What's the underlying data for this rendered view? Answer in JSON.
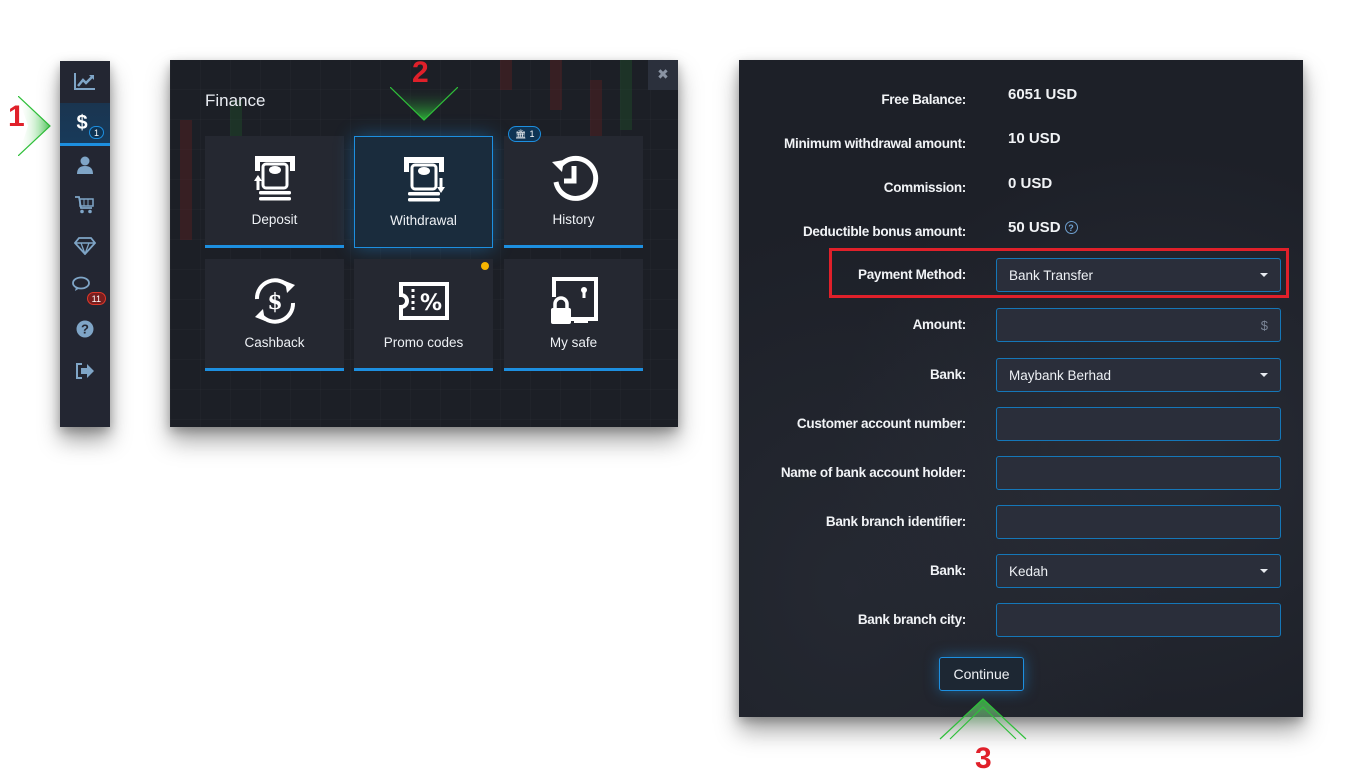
{
  "annotations": {
    "step1": "1",
    "step2": "2",
    "step3": "3",
    "arrow_color": "#2fbf3a",
    "number_color": "#e0202a"
  },
  "sidebar": {
    "items": [
      {
        "name": "chart",
        "icon": "chart-line-icon"
      },
      {
        "name": "finance",
        "icon": "dollar-icon",
        "active": true,
        "badge": "1"
      },
      {
        "name": "profile",
        "icon": "user-icon"
      },
      {
        "name": "market",
        "icon": "cart-icon"
      },
      {
        "name": "achievements",
        "icon": "diamond-icon"
      },
      {
        "name": "chat",
        "icon": "chat-icon",
        "badge": "11"
      },
      {
        "name": "help",
        "icon": "help-icon"
      },
      {
        "name": "logout",
        "icon": "logout-icon"
      }
    ]
  },
  "finance": {
    "title": "Finance",
    "close_label": "✖",
    "tiles": [
      {
        "label": "Deposit",
        "icon": "deposit-icon"
      },
      {
        "label": "Withdrawal",
        "icon": "withdrawal-icon",
        "selected": true
      },
      {
        "label": "History",
        "icon": "history-icon",
        "badge": "1"
      },
      {
        "label": "Cashback",
        "icon": "cashback-icon"
      },
      {
        "label": "Promo codes",
        "icon": "promo-icon",
        "dot": true
      },
      {
        "label": "My safe",
        "icon": "safe-icon"
      }
    ]
  },
  "withdrawal_form": {
    "info": [
      {
        "label": "Free Balance:",
        "value": "6051 USD"
      },
      {
        "label": "Minimum withdrawal amount:",
        "value": "10 USD"
      },
      {
        "label": "Commission:",
        "value": "0 USD"
      },
      {
        "label": "Deductible bonus amount:",
        "value": "50 USD"
      }
    ],
    "fields": [
      {
        "label": "Payment Method:",
        "type": "select",
        "value": "Bank Transfer"
      },
      {
        "label": "Amount:",
        "type": "input",
        "value": "",
        "suffix": "$"
      },
      {
        "label": "Bank:",
        "type": "select",
        "value": "Maybank Berhad"
      },
      {
        "label": "Customer account number:",
        "type": "input",
        "value": ""
      },
      {
        "label": "Name of bank account holder:",
        "type": "input",
        "value": ""
      },
      {
        "label": "Bank branch identifier:",
        "type": "input",
        "value": ""
      },
      {
        "label": "Bank:",
        "type": "select",
        "value": "Kedah"
      },
      {
        "label": "Bank branch city:",
        "type": "input",
        "value": ""
      }
    ],
    "continue_label": "Continue"
  }
}
